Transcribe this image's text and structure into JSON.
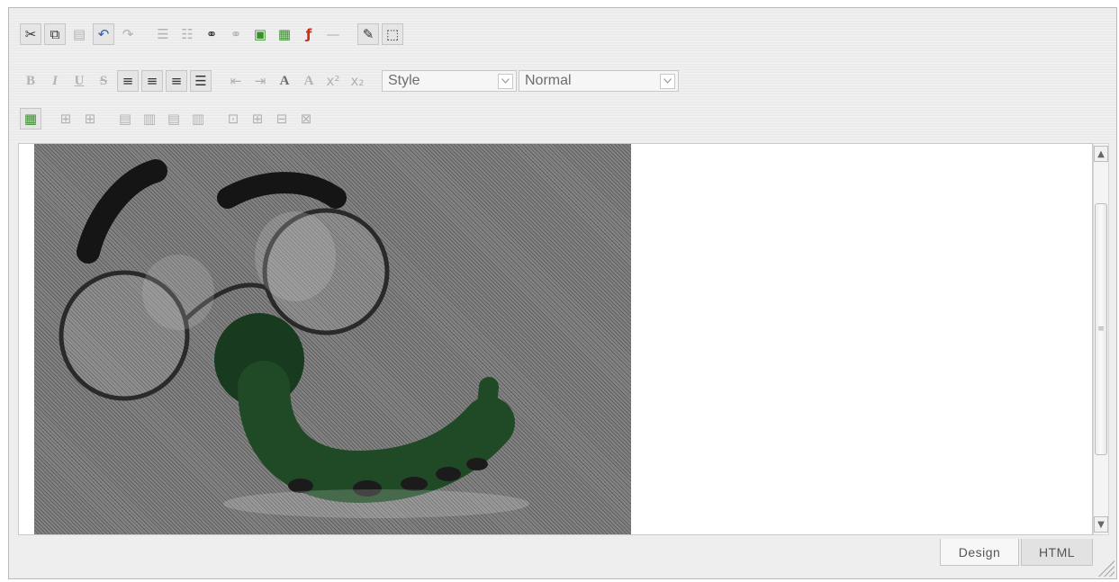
{
  "toolbar": {
    "style_select": {
      "value": "Style"
    },
    "format_select": {
      "value": "Normal"
    }
  },
  "tabs": {
    "design": "Design",
    "html": "HTML"
  },
  "colors": {
    "toolbar_bg": "#efefef",
    "content_bg": "#ffffff",
    "accent_blue": "#2d5fa8",
    "flash_red": "#d02a12"
  },
  "icons": {
    "row1": [
      "cut-icon",
      "copy-icon",
      "paste-icon",
      "undo-icon",
      "redo-icon",
      "ordered-list-icon",
      "unordered-list-icon",
      "insert-link-icon",
      "remove-link-icon",
      "insert-image-icon",
      "image-gallery-icon",
      "flash-icon",
      "horizontal-rule-icon",
      "edit-icon",
      "show-borders-icon"
    ],
    "row2": [
      "bold-icon",
      "italic-icon",
      "underline-icon",
      "strikethrough-icon",
      "align-left-icon",
      "align-center-icon",
      "align-right-icon",
      "justify-icon",
      "outdent-icon",
      "indent-icon",
      "font-color-icon",
      "highlight-icon",
      "superscript-icon",
      "subscript-icon"
    ],
    "row3": [
      "insert-table-icon",
      "insert-row-above-icon",
      "insert-row-below-icon",
      "delete-row-icon",
      "insert-column-left-icon",
      "insert-column-right-icon",
      "delete-column-icon",
      "merge-cells-icon",
      "split-cell-icon",
      "cell-properties-icon",
      "table-properties-icon"
    ]
  }
}
